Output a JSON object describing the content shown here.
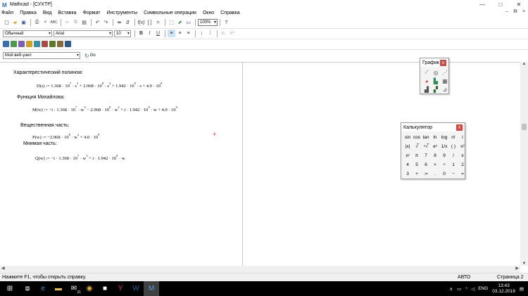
{
  "window": {
    "app_letter": "M",
    "title": "Mathcad - [СУХТР]",
    "minimize": "—",
    "maximize": "□",
    "close": "✕"
  },
  "menu": {
    "items": [
      "Файл",
      "Правка",
      "Вид",
      "Вставка",
      "Формат",
      "Инструменты",
      "Символьные операции",
      "Окно",
      "Справка"
    ],
    "doc_minimize": "–",
    "doc_restore": "⧉",
    "doc_close": "×"
  },
  "toolbar": {
    "style_value": "Обычный",
    "font_value": "Arial",
    "size_value": "10",
    "zoom_value": "100%",
    "bold": "B",
    "italic": "I",
    "underline": "U",
    "web_value": "Мой веб-узел",
    "go_label": "Go"
  },
  "worksheet": {
    "char_poly_label": "Характерестический полином:",
    "mikhailov_label": "Функция Михайлова:",
    "real_label": "Вещественная часть:",
    "imag_label": "Мнимая часть:",
    "cursor_glyph": "+"
  },
  "graph_palette": {
    "title": "График",
    "close": "x",
    "icons": [
      "xy-plot-icon",
      "polar-plot-icon",
      "surface-plot-icon",
      "pie-plot-icon",
      "contour-plot-icon",
      "3d-bar-plot-icon",
      "scatter-plot-icon",
      "vector-field-plot-icon",
      "plot-wizard-icon"
    ]
  },
  "calculator": {
    "title": "Калькулятор",
    "close": "x",
    "keys": [
      "sin",
      "cos",
      "tan",
      "ln",
      "log",
      "n!",
      "i",
      "|x|",
      "√̅",
      "ⁿ√̅",
      "eˣ",
      "1/x",
      "( )",
      "x²",
      "xʸ",
      "π",
      "7",
      "8",
      "9",
      "/",
      "±",
      "4",
      "5",
      "6",
      "×",
      "÷",
      "1",
      "2",
      "3",
      "+",
      ":=",
      ".",
      "0",
      "−",
      "="
    ]
  },
  "status": {
    "help": "Нажмите F1, чтобы открыть справку.",
    "mode": "АВТО",
    "page": "Страница 2"
  },
  "taskbar": {
    "language": "ENG",
    "time": "13:43",
    "date": "03.12.2019",
    "badge": "21"
  }
}
